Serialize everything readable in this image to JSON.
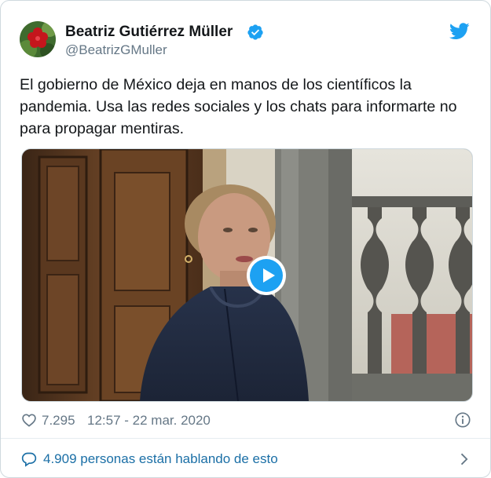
{
  "author": {
    "name": "Beatriz Gutiérrez Müller",
    "handle": "@BeatrizGMuller",
    "verified": true,
    "avatar_icon": "red-flower-avatar"
  },
  "tweet": {
    "text": "El gobierno de México deja en manos de los científicos la pandemia. Usa las redes sociales y los chats para informarte no para propagar mentiras.",
    "media_type": "video",
    "media_icon": "play-icon"
  },
  "meta": {
    "like_count": "7.295",
    "timestamp": "12:57 - 22 mar. 2020"
  },
  "footer": {
    "conversation_text": "4.909 personas están hablando de esto"
  },
  "colors": {
    "brand": "#1da1f2",
    "text": "#14171a",
    "secondary": "#657786",
    "link": "#1b6fa6",
    "border": "#cfd9de"
  },
  "icons": {
    "brand": "twitter-bird-icon",
    "verified": "verified-badge-icon",
    "like": "heart-icon",
    "info": "info-icon",
    "conversation": "speech-bubble-icon",
    "more": "chevron-right-icon"
  }
}
